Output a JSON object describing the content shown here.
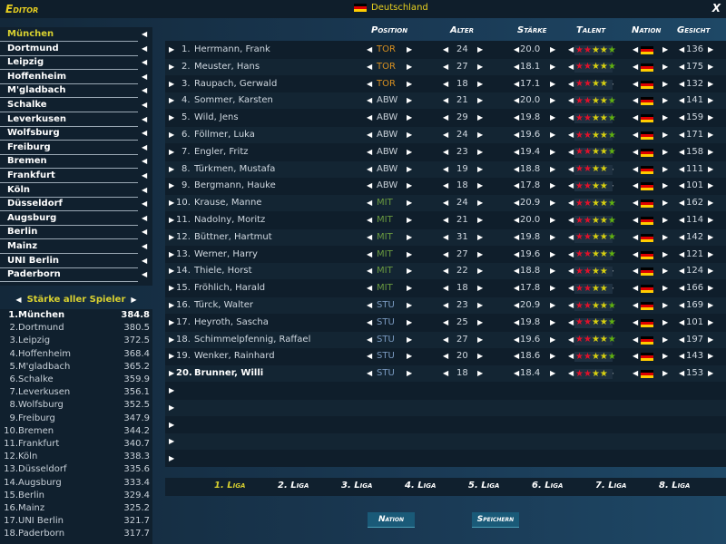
{
  "title": "Editor",
  "country": "Deutschland",
  "close_label": "X",
  "teams": [
    "München",
    "Dortmund",
    "Leipzig",
    "Hoffenheim",
    "M'gladbach",
    "Schalke",
    "Leverkusen",
    "Wolfsburg",
    "Freiburg",
    "Bremen",
    "Frankfurt",
    "Köln",
    "Düsseldorf",
    "Augsburg",
    "Berlin",
    "Mainz",
    "UNI Berlin",
    "Paderborn"
  ],
  "standings_title": "Stärke aller Spieler",
  "standings": [
    {
      "rank": "1.",
      "team": "München",
      "value": "384.8"
    },
    {
      "rank": "2.",
      "team": "Dortmund",
      "value": "380.5"
    },
    {
      "rank": "3.",
      "team": "Leipzig",
      "value": "372.5"
    },
    {
      "rank": "4.",
      "team": "Hoffenheim",
      "value": "368.4"
    },
    {
      "rank": "5.",
      "team": "M'gladbach",
      "value": "365.2"
    },
    {
      "rank": "6.",
      "team": "Schalke",
      "value": "359.9"
    },
    {
      "rank": "7.",
      "team": "Leverkusen",
      "value": "356.1"
    },
    {
      "rank": "8.",
      "team": "Wolfsburg",
      "value": "352.5"
    },
    {
      "rank": "9.",
      "team": "Freiburg",
      "value": "347.9"
    },
    {
      "rank": "10.",
      "team": "Bremen",
      "value": "344.2"
    },
    {
      "rank": "11.",
      "team": "Frankfurt",
      "value": "340.7"
    },
    {
      "rank": "12.",
      "team": "Köln",
      "value": "338.3"
    },
    {
      "rank": "13.",
      "team": "Düsseldorf",
      "value": "335.6"
    },
    {
      "rank": "14.",
      "team": "Augsburg",
      "value": "333.4"
    },
    {
      "rank": "15.",
      "team": "Berlin",
      "value": "329.4"
    },
    {
      "rank": "16.",
      "team": "Mainz",
      "value": "325.2"
    },
    {
      "rank": "17.",
      "team": "UNI Berlin",
      "value": "321.7"
    },
    {
      "rank": "18.",
      "team": "Paderborn",
      "value": "317.7"
    }
  ],
  "columns": {
    "position": "Position",
    "alter": "Alter",
    "staerke": "Stärke",
    "talent": "Talent",
    "nation": "Nation",
    "gesicht": "Gesicht"
  },
  "players": [
    {
      "no": "1.",
      "name": "Herrmann, Frank",
      "pos": "TOR",
      "age": "24",
      "str": "20.0",
      "talent": 5,
      "face": "136"
    },
    {
      "no": "2.",
      "name": "Meuster, Hans",
      "pos": "TOR",
      "age": "27",
      "str": "18.1",
      "talent": 5,
      "face": "175"
    },
    {
      "no": "3.",
      "name": "Raupach, Gerwald",
      "pos": "TOR",
      "age": "18",
      "str": "17.1",
      "talent": 4,
      "face": "132"
    },
    {
      "no": "4.",
      "name": "Sommer, Karsten",
      "pos": "ABW",
      "age": "21",
      "str": "20.0",
      "talent": 5,
      "face": "141"
    },
    {
      "no": "5.",
      "name": "Wild, Jens",
      "pos": "ABW",
      "age": "29",
      "str": "19.8",
      "talent": 5,
      "face": "159"
    },
    {
      "no": "6.",
      "name": "Föllmer, Luka",
      "pos": "ABW",
      "age": "24",
      "str": "19.6",
      "talent": 5,
      "face": "171"
    },
    {
      "no": "7.",
      "name": "Engler, Fritz",
      "pos": "ABW",
      "age": "23",
      "str": "19.4",
      "talent": 5,
      "face": "158"
    },
    {
      "no": "8.",
      "name": "Türkmen, Mustafa",
      "pos": "ABW",
      "age": "19",
      "str": "18.8",
      "talent": 4,
      "face": "111"
    },
    {
      "no": "9.",
      "name": "Bergmann, Hauke",
      "pos": "ABW",
      "age": "18",
      "str": "17.8",
      "talent": 4,
      "face": "101"
    },
    {
      "no": "10.",
      "name": "Krause, Manne",
      "pos": "MIT",
      "age": "24",
      "str": "20.9",
      "talent": 5,
      "face": "162"
    },
    {
      "no": "11.",
      "name": "Nadolny, Moritz",
      "pos": "MIT",
      "age": "21",
      "str": "20.0",
      "talent": 5,
      "face": "114"
    },
    {
      "no": "12.",
      "name": "Büttner, Hartmut",
      "pos": "MIT",
      "age": "31",
      "str": "19.8",
      "talent": 5,
      "face": "142"
    },
    {
      "no": "13.",
      "name": "Werner, Harry",
      "pos": "MIT",
      "age": "27",
      "str": "19.6",
      "talent": 5,
      "face": "121"
    },
    {
      "no": "14.",
      "name": "Thiele, Horst",
      "pos": "MIT",
      "age": "22",
      "str": "18.8",
      "talent": 4,
      "face": "124"
    },
    {
      "no": "15.",
      "name": "Fröhlich, Harald",
      "pos": "MIT",
      "age": "18",
      "str": "17.8",
      "talent": 4,
      "face": "166"
    },
    {
      "no": "16.",
      "name": "Türck, Walter",
      "pos": "STU",
      "age": "23",
      "str": "20.9",
      "talent": 5,
      "face": "169"
    },
    {
      "no": "17.",
      "name": "Heyroth, Sascha",
      "pos": "STU",
      "age": "25",
      "str": "19.8",
      "talent": 5,
      "face": "101"
    },
    {
      "no": "18.",
      "name": "Schimmelpfennig, Raffael",
      "pos": "STU",
      "age": "27",
      "str": "19.6",
      "talent": 5,
      "face": "197"
    },
    {
      "no": "19.",
      "name": "Wenker, Rainhard",
      "pos": "STU",
      "age": "20",
      "str": "18.6",
      "talent": 5,
      "face": "143"
    },
    {
      "no": "20.",
      "name": "Brunner, Willi",
      "pos": "STU",
      "age": "18",
      "str": "18.4",
      "talent": 4,
      "face": "153"
    }
  ],
  "ligas": [
    "1. Liga",
    "2. Liga",
    "3. Liga",
    "4. Liga",
    "5. Liga",
    "6. Liga",
    "7. Liga",
    "8. Liga"
  ],
  "buttons": {
    "nation": "Nation",
    "save": "Speichern"
  },
  "colors": {
    "accent": "#d8d030",
    "tor": "#d89020",
    "mit": "#6a9a40",
    "stu": "#7a9ac0"
  }
}
